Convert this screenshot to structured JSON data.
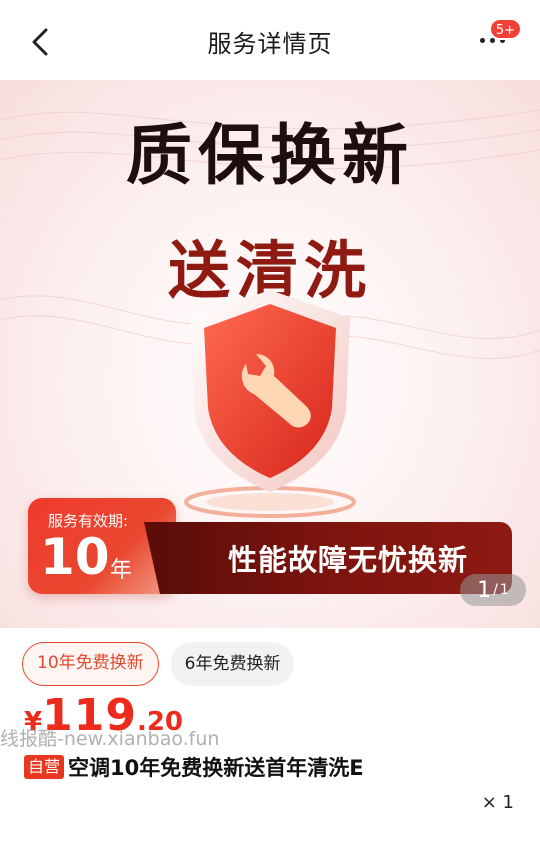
{
  "nav": {
    "title": "服务详情页",
    "badge": "5+"
  },
  "hero": {
    "title_line1": "质保换新",
    "title_line2": "送清洗",
    "validity_label": "服务有效期:",
    "validity_value": "10",
    "validity_unit": "年",
    "slogan": "性能故障无忧换新",
    "pager_current": "1",
    "pager_separator": "/",
    "pager_total": "1"
  },
  "options": [
    {
      "label": "10年免费换新",
      "selected": true
    },
    {
      "label": "6年免费换新",
      "selected": false
    }
  ],
  "price": {
    "symbol": "¥",
    "integer": "119",
    "decimal": ".20"
  },
  "watermark": "线报酷-new.xianbao.fun",
  "product": {
    "tag": "自营",
    "title": "空调10年免费换新送首年清洗E",
    "quantity": "× 1"
  },
  "colors": {
    "accent": "#ec2b1d",
    "dark_red": "#7e140e"
  }
}
